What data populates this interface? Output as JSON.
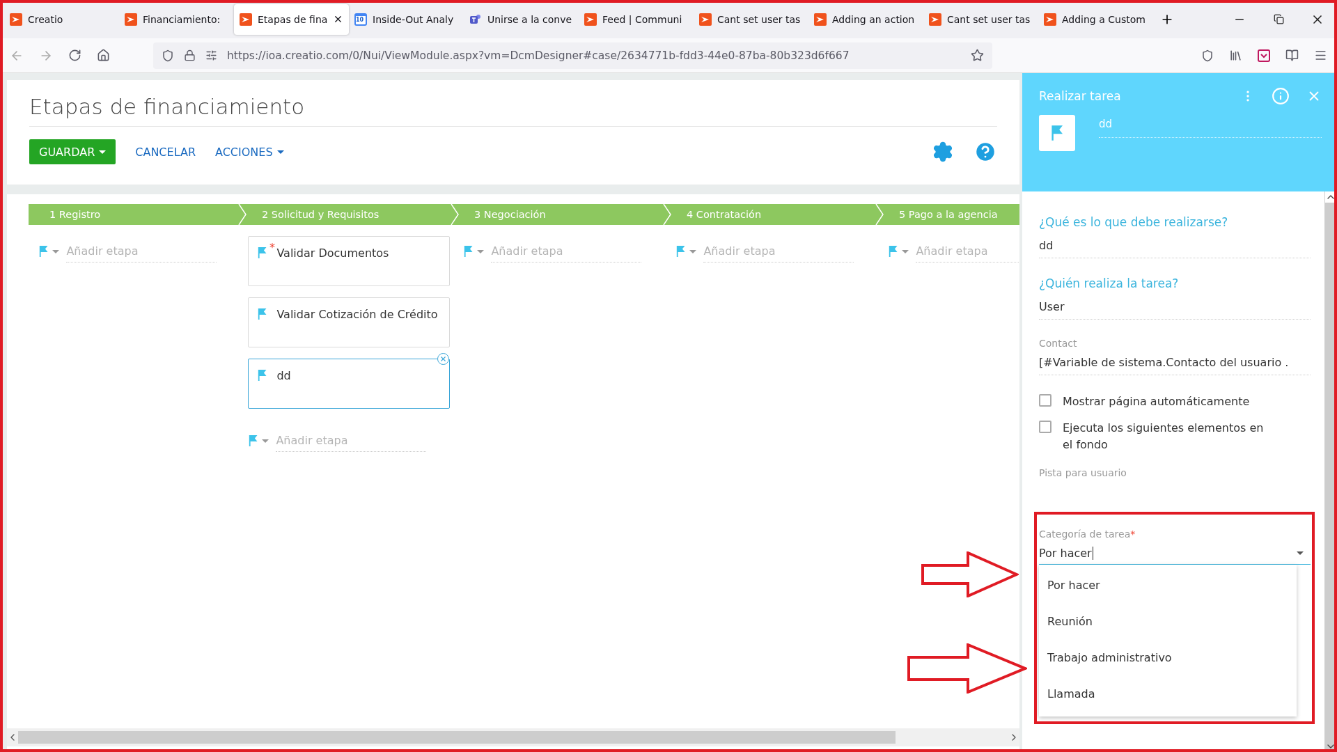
{
  "browser": {
    "tabs": [
      {
        "title": "Creatio",
        "kind": "creatio",
        "selected": false
      },
      {
        "title": "Financiamiento:",
        "kind": "creatio",
        "selected": false
      },
      {
        "title": "Etapas de fina",
        "kind": "creatio",
        "selected": true
      },
      {
        "title": "Inside-Out Analy",
        "kind": "calendar",
        "badge": "10",
        "selected": false
      },
      {
        "title": "Unirse a la conve",
        "kind": "teams",
        "selected": false
      },
      {
        "title": "Feed | Communi",
        "kind": "creatio",
        "selected": false
      },
      {
        "title": "Cant set user tas",
        "kind": "creatio",
        "selected": false
      },
      {
        "title": "Adding an action",
        "kind": "creatio",
        "selected": false
      },
      {
        "title": "Cant set user tas",
        "kind": "creatio",
        "selected": false
      },
      {
        "title": "Adding a Custom",
        "kind": "creatio",
        "selected": false
      }
    ],
    "url": "https://ioa.creatio.com/0/Nui/ViewModule.aspx?vm=DcmDesigner#case/2634771b-fdd3-44e0-87ba-80b323d6f667"
  },
  "page": {
    "title": "Etapas de financiamiento",
    "buttons": [
      {
        "label": "GUARDAR",
        "kind": "primary"
      },
      {
        "label": "CANCELAR",
        "kind": "link"
      },
      {
        "label": "ACCIONES",
        "kind": "menu"
      }
    ]
  },
  "stages": [
    {
      "label": "1 Registro",
      "placeholder": "Añadir etapa"
    },
    {
      "label": "2 Solicitud y Requisitos",
      "items": [
        {
          "title": "Validar Documentos",
          "required_mark": "*",
          "selected": false
        },
        {
          "title": "Validar Cotización de Crédito",
          "selected": false
        },
        {
          "title": "dd",
          "selected": true
        }
      ],
      "placeholder": "Añadir etapa"
    },
    {
      "label": "3 Negociación",
      "placeholder": "Añadir etapa"
    },
    {
      "label": "4 Contratación",
      "placeholder": "Añadir etapa"
    },
    {
      "label": "5 Pago a la agencia",
      "placeholder": "Añadir etapa"
    }
  ],
  "panel": {
    "title": "Realizar tarea",
    "name": "dd",
    "fields": [
      {
        "kind": "question",
        "label": "¿Qué es lo que debe realizarse?",
        "value": "dd"
      },
      {
        "kind": "question",
        "label": "¿Quién realiza la tarea?",
        "value": "User"
      },
      {
        "kind": "lookup",
        "label": "Contact",
        "value": "[#Variable de sistema.Contacto del usuario ."
      }
    ],
    "checkboxes": [
      {
        "label": "Mostrar página automáticamente",
        "checked": false
      },
      {
        "label": "Ejecuta los siguientes elementos en el fondo",
        "checked": false
      }
    ],
    "hint_label": "Pista para usuario",
    "category": {
      "label": "Categoría de tarea",
      "required_mark": "*",
      "value": "Por hacer",
      "options": [
        "Por hacer",
        "Reunión",
        "Trabajo administrativo",
        "Llamada"
      ]
    }
  }
}
